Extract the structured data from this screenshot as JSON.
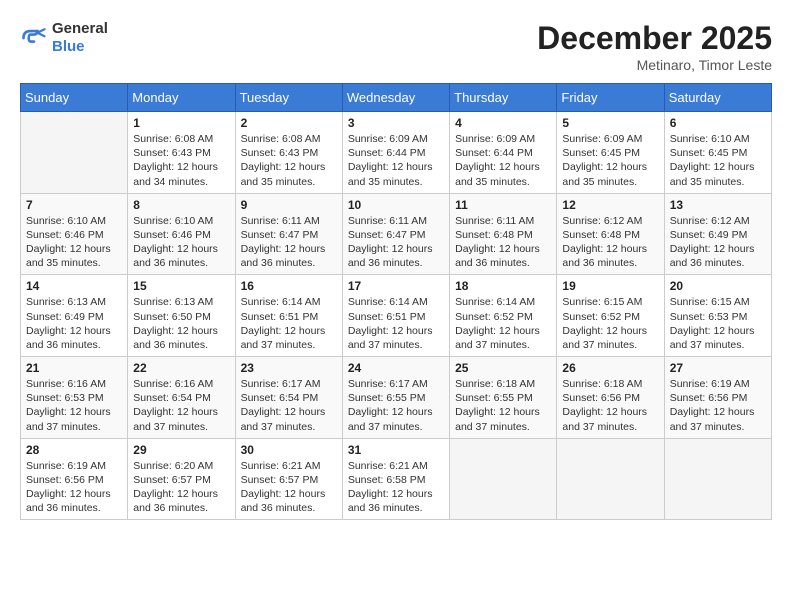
{
  "logo": {
    "general": "General",
    "blue": "Blue"
  },
  "header": {
    "month": "December 2025",
    "location": "Metinaro, Timor Leste"
  },
  "weekdays": [
    "Sunday",
    "Monday",
    "Tuesday",
    "Wednesday",
    "Thursday",
    "Friday",
    "Saturday"
  ],
  "weeks": [
    [
      {
        "day": "",
        "info": ""
      },
      {
        "day": "1",
        "info": "Sunrise: 6:08 AM\nSunset: 6:43 PM\nDaylight: 12 hours\nand 34 minutes."
      },
      {
        "day": "2",
        "info": "Sunrise: 6:08 AM\nSunset: 6:43 PM\nDaylight: 12 hours\nand 35 minutes."
      },
      {
        "day": "3",
        "info": "Sunrise: 6:09 AM\nSunset: 6:44 PM\nDaylight: 12 hours\nand 35 minutes."
      },
      {
        "day": "4",
        "info": "Sunrise: 6:09 AM\nSunset: 6:44 PM\nDaylight: 12 hours\nand 35 minutes."
      },
      {
        "day": "5",
        "info": "Sunrise: 6:09 AM\nSunset: 6:45 PM\nDaylight: 12 hours\nand 35 minutes."
      },
      {
        "day": "6",
        "info": "Sunrise: 6:10 AM\nSunset: 6:45 PM\nDaylight: 12 hours\nand 35 minutes."
      }
    ],
    [
      {
        "day": "7",
        "info": "Sunrise: 6:10 AM\nSunset: 6:46 PM\nDaylight: 12 hours\nand 35 minutes."
      },
      {
        "day": "8",
        "info": "Sunrise: 6:10 AM\nSunset: 6:46 PM\nDaylight: 12 hours\nand 36 minutes."
      },
      {
        "day": "9",
        "info": "Sunrise: 6:11 AM\nSunset: 6:47 PM\nDaylight: 12 hours\nand 36 minutes."
      },
      {
        "day": "10",
        "info": "Sunrise: 6:11 AM\nSunset: 6:47 PM\nDaylight: 12 hours\nand 36 minutes."
      },
      {
        "day": "11",
        "info": "Sunrise: 6:11 AM\nSunset: 6:48 PM\nDaylight: 12 hours\nand 36 minutes."
      },
      {
        "day": "12",
        "info": "Sunrise: 6:12 AM\nSunset: 6:48 PM\nDaylight: 12 hours\nand 36 minutes."
      },
      {
        "day": "13",
        "info": "Sunrise: 6:12 AM\nSunset: 6:49 PM\nDaylight: 12 hours\nand 36 minutes."
      }
    ],
    [
      {
        "day": "14",
        "info": "Sunrise: 6:13 AM\nSunset: 6:49 PM\nDaylight: 12 hours\nand 36 minutes."
      },
      {
        "day": "15",
        "info": "Sunrise: 6:13 AM\nSunset: 6:50 PM\nDaylight: 12 hours\nand 36 minutes."
      },
      {
        "day": "16",
        "info": "Sunrise: 6:14 AM\nSunset: 6:51 PM\nDaylight: 12 hours\nand 37 minutes."
      },
      {
        "day": "17",
        "info": "Sunrise: 6:14 AM\nSunset: 6:51 PM\nDaylight: 12 hours\nand 37 minutes."
      },
      {
        "day": "18",
        "info": "Sunrise: 6:14 AM\nSunset: 6:52 PM\nDaylight: 12 hours\nand 37 minutes."
      },
      {
        "day": "19",
        "info": "Sunrise: 6:15 AM\nSunset: 6:52 PM\nDaylight: 12 hours\nand 37 minutes."
      },
      {
        "day": "20",
        "info": "Sunrise: 6:15 AM\nSunset: 6:53 PM\nDaylight: 12 hours\nand 37 minutes."
      }
    ],
    [
      {
        "day": "21",
        "info": "Sunrise: 6:16 AM\nSunset: 6:53 PM\nDaylight: 12 hours\nand 37 minutes."
      },
      {
        "day": "22",
        "info": "Sunrise: 6:16 AM\nSunset: 6:54 PM\nDaylight: 12 hours\nand 37 minutes."
      },
      {
        "day": "23",
        "info": "Sunrise: 6:17 AM\nSunset: 6:54 PM\nDaylight: 12 hours\nand 37 minutes."
      },
      {
        "day": "24",
        "info": "Sunrise: 6:17 AM\nSunset: 6:55 PM\nDaylight: 12 hours\nand 37 minutes."
      },
      {
        "day": "25",
        "info": "Sunrise: 6:18 AM\nSunset: 6:55 PM\nDaylight: 12 hours\nand 37 minutes."
      },
      {
        "day": "26",
        "info": "Sunrise: 6:18 AM\nSunset: 6:56 PM\nDaylight: 12 hours\nand 37 minutes."
      },
      {
        "day": "27",
        "info": "Sunrise: 6:19 AM\nSunset: 6:56 PM\nDaylight: 12 hours\nand 37 minutes."
      }
    ],
    [
      {
        "day": "28",
        "info": "Sunrise: 6:19 AM\nSunset: 6:56 PM\nDaylight: 12 hours\nand 36 minutes."
      },
      {
        "day": "29",
        "info": "Sunrise: 6:20 AM\nSunset: 6:57 PM\nDaylight: 12 hours\nand 36 minutes."
      },
      {
        "day": "30",
        "info": "Sunrise: 6:21 AM\nSunset: 6:57 PM\nDaylight: 12 hours\nand 36 minutes."
      },
      {
        "day": "31",
        "info": "Sunrise: 6:21 AM\nSunset: 6:58 PM\nDaylight: 12 hours\nand 36 minutes."
      },
      {
        "day": "",
        "info": ""
      },
      {
        "day": "",
        "info": ""
      },
      {
        "day": "",
        "info": ""
      }
    ]
  ]
}
